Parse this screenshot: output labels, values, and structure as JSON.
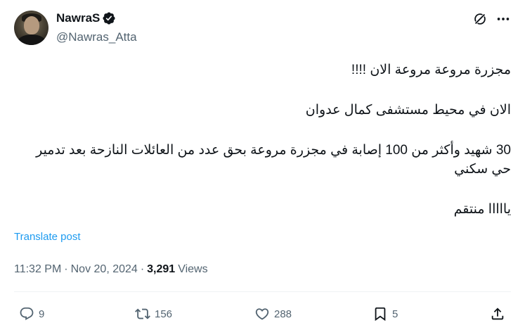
{
  "author": {
    "display_name": "NawraS",
    "handle": "@Nawras_Atta",
    "verified": true,
    "avatar_icon": "user-avatar"
  },
  "header_icons": {
    "grok": "grok-icon",
    "more": "more-options-icon"
  },
  "tweet": {
    "paragraphs": [
      [
        "مجزرة مروعة مروعة الان !!!!"
      ],
      [
        " الان في محيط مستشفى كمال عدوان"
      ],
      [
        "30 شهيد وأكثر من 100 إصابة في مجزرة مروعة بحق عدد من العائلات النازحة بعد تدمير حي سكني"
      ],
      [
        "يااااا منتقم"
      ]
    ],
    "translate_label": "Translate post",
    "time": "11:32 PM",
    "date": "Nov 20, 2024",
    "views_count": "3,291",
    "views_label": "Views"
  },
  "actions": {
    "replies": "9",
    "reposts": "156",
    "likes": "288",
    "bookmarks": "5"
  },
  "colors": {
    "text": "#0f1419",
    "secondary": "#536471",
    "link": "#1d9bf0",
    "verified": "#0f1419"
  }
}
